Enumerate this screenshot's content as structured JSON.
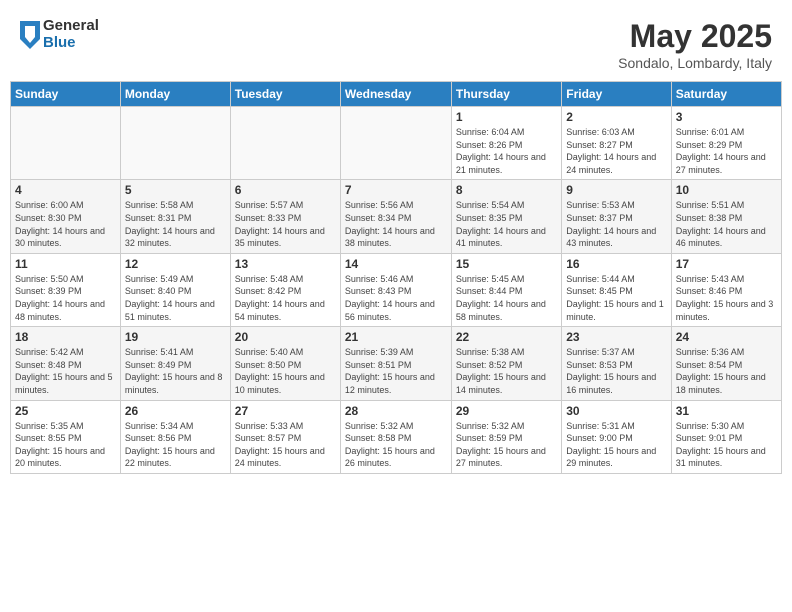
{
  "header": {
    "logo_general": "General",
    "logo_blue": "Blue",
    "month_title": "May 2025",
    "location": "Sondalo, Lombardy, Italy"
  },
  "weekdays": [
    "Sunday",
    "Monday",
    "Tuesday",
    "Wednesday",
    "Thursday",
    "Friday",
    "Saturday"
  ],
  "weeks": [
    [
      {
        "day": "",
        "sunrise": "",
        "sunset": "",
        "daylight": ""
      },
      {
        "day": "",
        "sunrise": "",
        "sunset": "",
        "daylight": ""
      },
      {
        "day": "",
        "sunrise": "",
        "sunset": "",
        "daylight": ""
      },
      {
        "day": "",
        "sunrise": "",
        "sunset": "",
        "daylight": ""
      },
      {
        "day": "1",
        "sunrise": "Sunrise: 6:04 AM",
        "sunset": "Sunset: 8:26 PM",
        "daylight": "Daylight: 14 hours and 21 minutes."
      },
      {
        "day": "2",
        "sunrise": "Sunrise: 6:03 AM",
        "sunset": "Sunset: 8:27 PM",
        "daylight": "Daylight: 14 hours and 24 minutes."
      },
      {
        "day": "3",
        "sunrise": "Sunrise: 6:01 AM",
        "sunset": "Sunset: 8:29 PM",
        "daylight": "Daylight: 14 hours and 27 minutes."
      }
    ],
    [
      {
        "day": "4",
        "sunrise": "Sunrise: 6:00 AM",
        "sunset": "Sunset: 8:30 PM",
        "daylight": "Daylight: 14 hours and 30 minutes."
      },
      {
        "day": "5",
        "sunrise": "Sunrise: 5:58 AM",
        "sunset": "Sunset: 8:31 PM",
        "daylight": "Daylight: 14 hours and 32 minutes."
      },
      {
        "day": "6",
        "sunrise": "Sunrise: 5:57 AM",
        "sunset": "Sunset: 8:33 PM",
        "daylight": "Daylight: 14 hours and 35 minutes."
      },
      {
        "day": "7",
        "sunrise": "Sunrise: 5:56 AM",
        "sunset": "Sunset: 8:34 PM",
        "daylight": "Daylight: 14 hours and 38 minutes."
      },
      {
        "day": "8",
        "sunrise": "Sunrise: 5:54 AM",
        "sunset": "Sunset: 8:35 PM",
        "daylight": "Daylight: 14 hours and 41 minutes."
      },
      {
        "day": "9",
        "sunrise": "Sunrise: 5:53 AM",
        "sunset": "Sunset: 8:37 PM",
        "daylight": "Daylight: 14 hours and 43 minutes."
      },
      {
        "day": "10",
        "sunrise": "Sunrise: 5:51 AM",
        "sunset": "Sunset: 8:38 PM",
        "daylight": "Daylight: 14 hours and 46 minutes."
      }
    ],
    [
      {
        "day": "11",
        "sunrise": "Sunrise: 5:50 AM",
        "sunset": "Sunset: 8:39 PM",
        "daylight": "Daylight: 14 hours and 48 minutes."
      },
      {
        "day": "12",
        "sunrise": "Sunrise: 5:49 AM",
        "sunset": "Sunset: 8:40 PM",
        "daylight": "Daylight: 14 hours and 51 minutes."
      },
      {
        "day": "13",
        "sunrise": "Sunrise: 5:48 AM",
        "sunset": "Sunset: 8:42 PM",
        "daylight": "Daylight: 14 hours and 54 minutes."
      },
      {
        "day": "14",
        "sunrise": "Sunrise: 5:46 AM",
        "sunset": "Sunset: 8:43 PM",
        "daylight": "Daylight: 14 hours and 56 minutes."
      },
      {
        "day": "15",
        "sunrise": "Sunrise: 5:45 AM",
        "sunset": "Sunset: 8:44 PM",
        "daylight": "Daylight: 14 hours and 58 minutes."
      },
      {
        "day": "16",
        "sunrise": "Sunrise: 5:44 AM",
        "sunset": "Sunset: 8:45 PM",
        "daylight": "Daylight: 15 hours and 1 minute."
      },
      {
        "day": "17",
        "sunrise": "Sunrise: 5:43 AM",
        "sunset": "Sunset: 8:46 PM",
        "daylight": "Daylight: 15 hours and 3 minutes."
      }
    ],
    [
      {
        "day": "18",
        "sunrise": "Sunrise: 5:42 AM",
        "sunset": "Sunset: 8:48 PM",
        "daylight": "Daylight: 15 hours and 5 minutes."
      },
      {
        "day": "19",
        "sunrise": "Sunrise: 5:41 AM",
        "sunset": "Sunset: 8:49 PM",
        "daylight": "Daylight: 15 hours and 8 minutes."
      },
      {
        "day": "20",
        "sunrise": "Sunrise: 5:40 AM",
        "sunset": "Sunset: 8:50 PM",
        "daylight": "Daylight: 15 hours and 10 minutes."
      },
      {
        "day": "21",
        "sunrise": "Sunrise: 5:39 AM",
        "sunset": "Sunset: 8:51 PM",
        "daylight": "Daylight: 15 hours and 12 minutes."
      },
      {
        "day": "22",
        "sunrise": "Sunrise: 5:38 AM",
        "sunset": "Sunset: 8:52 PM",
        "daylight": "Daylight: 15 hours and 14 minutes."
      },
      {
        "day": "23",
        "sunrise": "Sunrise: 5:37 AM",
        "sunset": "Sunset: 8:53 PM",
        "daylight": "Daylight: 15 hours and 16 minutes."
      },
      {
        "day": "24",
        "sunrise": "Sunrise: 5:36 AM",
        "sunset": "Sunset: 8:54 PM",
        "daylight": "Daylight: 15 hours and 18 minutes."
      }
    ],
    [
      {
        "day": "25",
        "sunrise": "Sunrise: 5:35 AM",
        "sunset": "Sunset: 8:55 PM",
        "daylight": "Daylight: 15 hours and 20 minutes."
      },
      {
        "day": "26",
        "sunrise": "Sunrise: 5:34 AM",
        "sunset": "Sunset: 8:56 PM",
        "daylight": "Daylight: 15 hours and 22 minutes."
      },
      {
        "day": "27",
        "sunrise": "Sunrise: 5:33 AM",
        "sunset": "Sunset: 8:57 PM",
        "daylight": "Daylight: 15 hours and 24 minutes."
      },
      {
        "day": "28",
        "sunrise": "Sunrise: 5:32 AM",
        "sunset": "Sunset: 8:58 PM",
        "daylight": "Daylight: 15 hours and 26 minutes."
      },
      {
        "day": "29",
        "sunrise": "Sunrise: 5:32 AM",
        "sunset": "Sunset: 8:59 PM",
        "daylight": "Daylight: 15 hours and 27 minutes."
      },
      {
        "day": "30",
        "sunrise": "Sunrise: 5:31 AM",
        "sunset": "Sunset: 9:00 PM",
        "daylight": "Daylight: 15 hours and 29 minutes."
      },
      {
        "day": "31",
        "sunrise": "Sunrise: 5:30 AM",
        "sunset": "Sunset: 9:01 PM",
        "daylight": "Daylight: 15 hours and 31 minutes."
      }
    ]
  ]
}
